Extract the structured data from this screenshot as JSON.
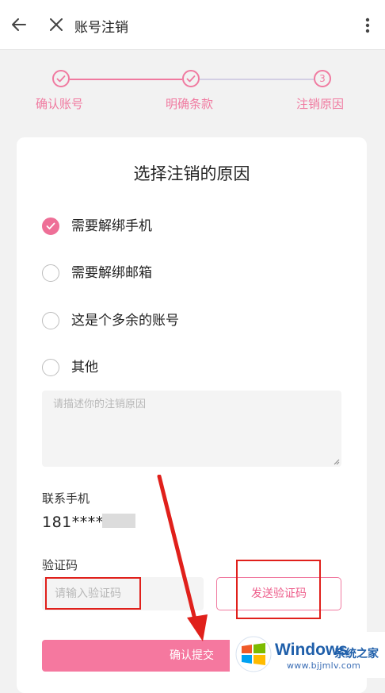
{
  "header": {
    "title": "账号注销",
    "back_icon": "arrow-left-icon",
    "close_icon": "close-icon",
    "more_icon": "more-vertical-icon"
  },
  "steps": [
    {
      "label": "确认账号",
      "state": "done"
    },
    {
      "label": "明确条款",
      "state": "done"
    },
    {
      "label": "注销原因",
      "state": "current",
      "number": "3"
    }
  ],
  "form": {
    "title": "选择注销的原因",
    "options": [
      {
        "label": "需要解绑手机",
        "checked": true
      },
      {
        "label": "需要解绑邮箱",
        "checked": false
      },
      {
        "label": "这是个多余的账号",
        "checked": false
      },
      {
        "label": "其他",
        "checked": false
      }
    ],
    "reason_placeholder": "请描述你的注销原因",
    "contact_label": "联系手机",
    "contact_value": "181*****",
    "code_label": "验证码",
    "code_placeholder": "请输入验证码",
    "send_code_label": "发送验证码",
    "submit_label": "确认提交"
  },
  "watermark": {
    "brand": "Windows",
    "brand_cn": "系统之家",
    "url": "www.bjjmlv.com"
  },
  "colors": {
    "accent": "#f07aa0",
    "button": "#f5789f",
    "annotation": "#e0201b",
    "watermark": "#1f5faa"
  }
}
